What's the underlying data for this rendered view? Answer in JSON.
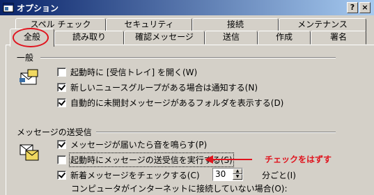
{
  "window": {
    "title": "オプション",
    "help_button": "?",
    "close_button": "×"
  },
  "tabs": {
    "row1": [
      "スペル チェック",
      "セキュリティ",
      "接続",
      "メンテナンス"
    ],
    "row2": [
      "全般",
      "読み取り",
      "確認メッセージ",
      "送信",
      "作成",
      "署名"
    ],
    "active": "全般"
  },
  "general": {
    "title": "一般",
    "options": [
      {
        "label": "起動時に [受信トレイ] を開く(W)",
        "checked": false
      },
      {
        "label": "新しいニュースグループがある場合は通知する(N)",
        "checked": true
      },
      {
        "label": "自動的に未開封メッセージがあるフォルダを表示する(D)",
        "checked": true
      }
    ]
  },
  "send_receive": {
    "title": "メッセージの送受信",
    "options": [
      {
        "label": "メッセージが届いたら音を鳴らす(P)",
        "checked": true
      },
      {
        "label": "起動時にメッセージの送受信を実行する(S)",
        "checked": false
      },
      {
        "label": "新着メッセージをチェックする(C)",
        "checked": true
      }
    ],
    "interval_value": "30",
    "interval_unit": "分ごと(I)",
    "offline_label": "コンピュータがインターネットに接続していない場合(O):"
  },
  "annotation": {
    "note": "チェックをはずす",
    "color": "#e0141e"
  },
  "colors": {
    "titlebar_start": "#0a246a",
    "titlebar_end": "#a6caf0",
    "face": "#d4d0c8"
  }
}
